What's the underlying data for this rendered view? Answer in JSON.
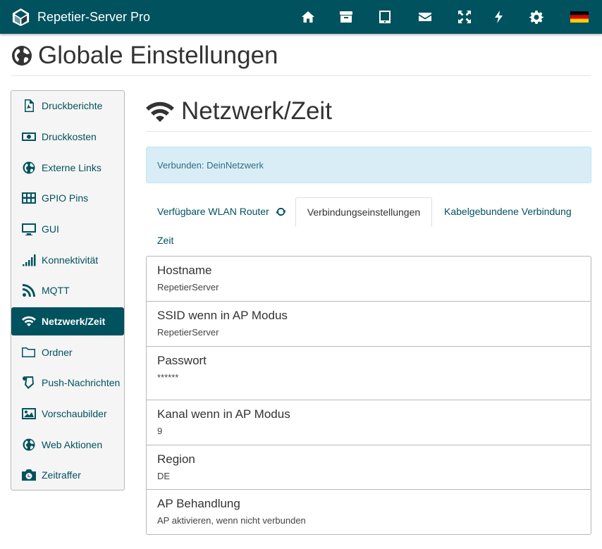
{
  "app": {
    "title": "Repetier-Server Pro"
  },
  "nav_icons": [
    "home-icon",
    "archive-icon",
    "tablet-icon",
    "envelope-icon",
    "expand-icon",
    "bolt-icon",
    "gear-icon",
    "german-flag-icon"
  ],
  "page": {
    "title": "Globale Einstellungen"
  },
  "sidebar": {
    "items": [
      {
        "label": "Druckberichte",
        "icon": "file-pdf-icon"
      },
      {
        "label": "Druckkosten",
        "icon": "money-icon"
      },
      {
        "label": "Externe Links",
        "icon": "globe-icon"
      },
      {
        "label": "GPIO Pins",
        "icon": "grid-icon"
      },
      {
        "label": "GUI",
        "icon": "monitor-icon"
      },
      {
        "label": "Konnektivität",
        "icon": "signal-bars-icon"
      },
      {
        "label": "MQTT",
        "icon": "rss-icon"
      },
      {
        "label": "Netzwerk/Zeit",
        "icon": "wifi-icon",
        "active": true
      },
      {
        "label": "Ordner",
        "icon": "folder-icon"
      },
      {
        "label": "Push-Nachrichten",
        "icon": "mobile-notification-icon"
      },
      {
        "label": "Vorschaubilder",
        "icon": "image-icon"
      },
      {
        "label": "Web Aktionen",
        "icon": "globe-icon"
      },
      {
        "label": "Zeitraffer",
        "icon": "camera-icon"
      }
    ]
  },
  "section": {
    "title": "Netzwerk/Zeit"
  },
  "alert": {
    "text": "Verbunden: DeinNetzwerk"
  },
  "tabs": [
    {
      "label": "Verfügbare WLAN Router"
    },
    {
      "label": "Verbindungseinstellungen",
      "active": true
    },
    {
      "label": "Kabelgebundene Verbindung"
    },
    {
      "label": "Zeit"
    }
  ],
  "settings": [
    {
      "heading": "Hostname",
      "value": "RepetierServer"
    },
    {
      "heading": "SSID wenn in AP Modus",
      "value": "RepetierServer"
    },
    {
      "heading": "Passwort",
      "value": "******"
    },
    {
      "heading": "Kanal wenn in AP Modus",
      "value": "9"
    },
    {
      "heading": "Region",
      "value": "DE"
    },
    {
      "heading": "AP Behandlung",
      "value": "AP aktivieren, wenn nicht verbunden"
    }
  ],
  "colors": {
    "navbar": "#00525e",
    "accent": "#00525e",
    "alert_bg": "#d9edf7",
    "alert_text": "#2f6e82"
  }
}
